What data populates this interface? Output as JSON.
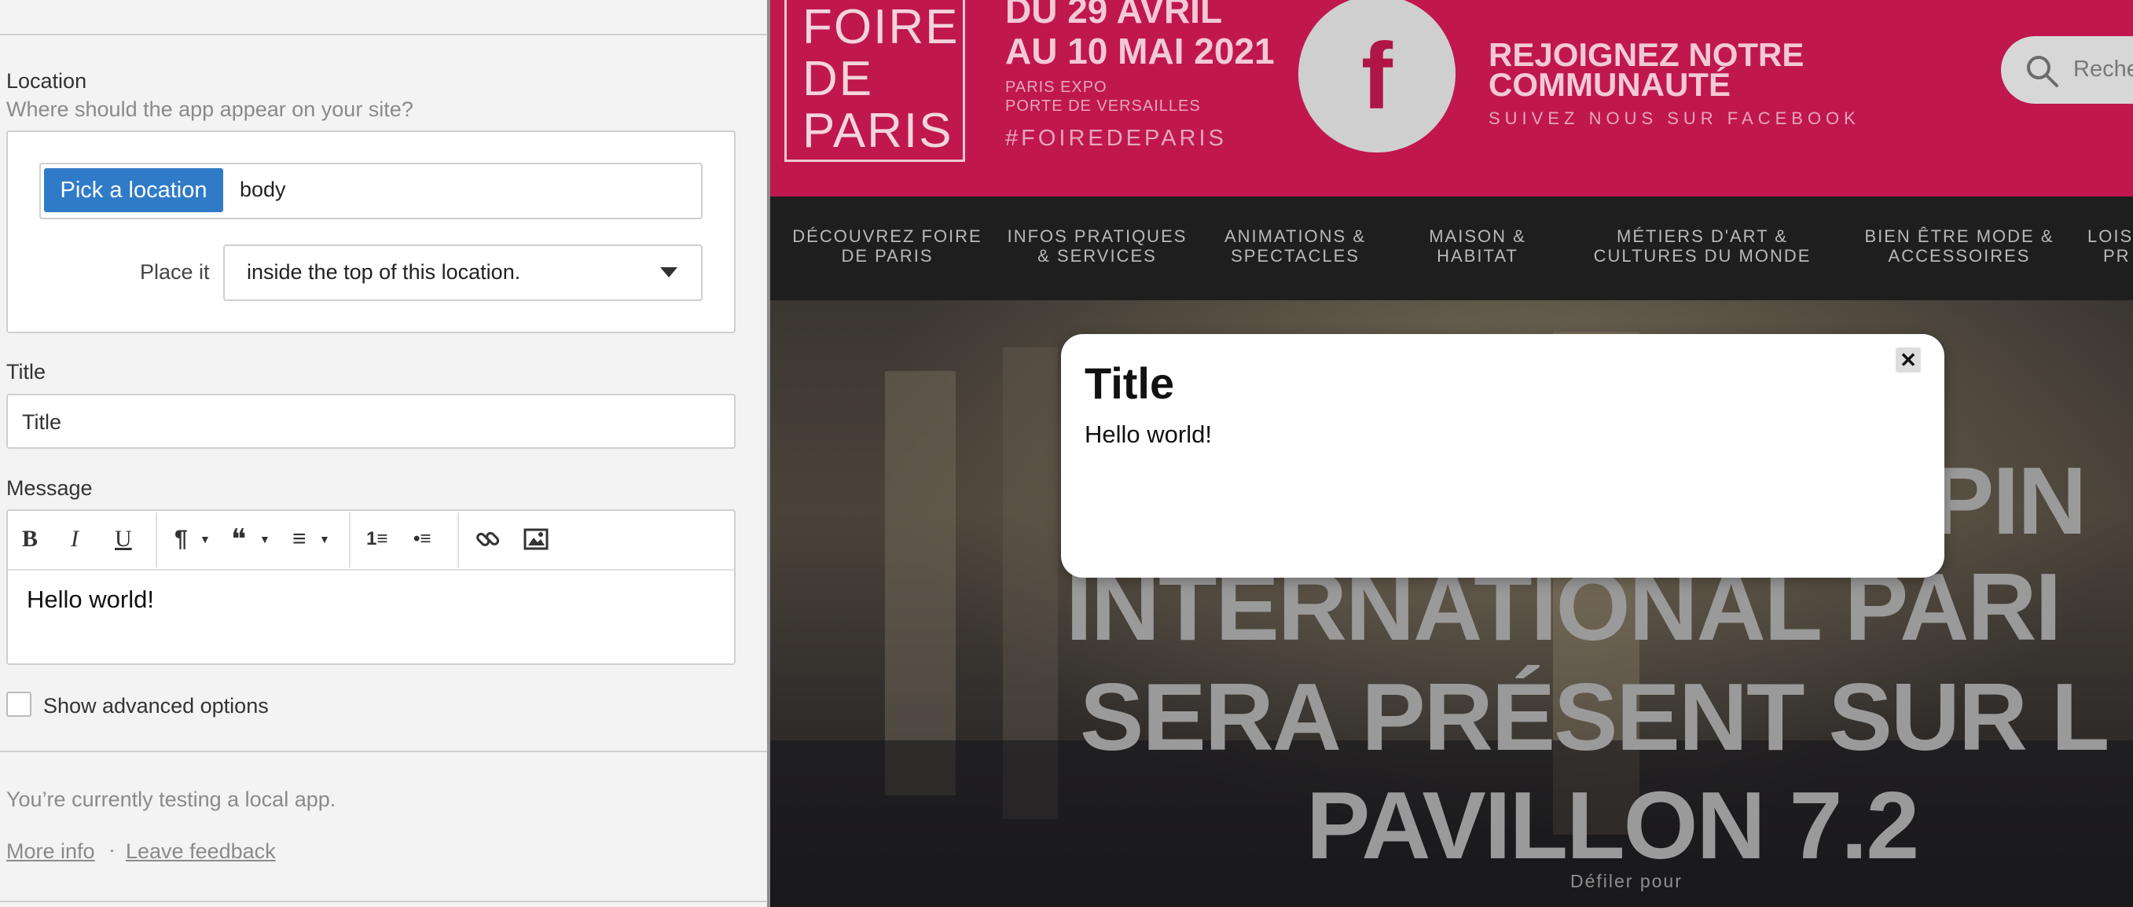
{
  "panel": {
    "location_label": "Location",
    "location_help": "Where should the app appear on your site?",
    "pick_button": "Pick a location",
    "location_value": "body",
    "place_label": "Place it",
    "place_value": "inside the top of this location.",
    "title_label": "Title",
    "title_value": "Title",
    "message_label": "Message",
    "editor_text": "Hello world!",
    "advanced_label": "Show advanced options",
    "advanced_checked": false,
    "testing_text": "You’re currently testing a local app.",
    "more_info": "More info",
    "separator": "·",
    "feedback": "Leave feedback",
    "toolbar": {
      "bold": "B",
      "italic": "I",
      "underline": "U",
      "paragraph": "¶",
      "quote": "❝",
      "align": "≡",
      "ordered_list": "1≡",
      "bullet_list": "•≡",
      "link": "🔗",
      "image": "▣"
    }
  },
  "site": {
    "logo_lines": [
      "FOIRE",
      "DE",
      "PARIS"
    ],
    "dates_line1": "DU 29 AVRIL",
    "dates_line2": "AU 10 MAI 2021",
    "venue_line1": "PARIS EXPO",
    "venue_line2": "PORTE DE VERSAILLES",
    "hashtag": "#FOIREDEPARIS",
    "facebook_glyph": "f",
    "join_line1": "REJOIGNEZ NOTRE",
    "join_line2": "COMMUNAUTÉ",
    "follow": "SUIVEZ NOUS SUR FACEBOOK",
    "search_placeholder": "Reche",
    "nav": [
      {
        "line1": "DÉCOUVREZ FOIRE",
        "line2": "DE PARIS"
      },
      {
        "line1": "INFOS PRATIQUES",
        "line2": "& SERVICES"
      },
      {
        "line1": "ANIMATIONS &",
        "line2": "SPECTACLES"
      },
      {
        "line1": "MAISON &",
        "line2": "HABITAT"
      },
      {
        "line1": "MÉTIERS D'ART &",
        "line2": "CULTURES DU MONDE"
      },
      {
        "line1": "BIEN ÊTRE MODE &",
        "line2": "ACCESSOIRES"
      },
      {
        "line1": "LOIS",
        "line2": "PR"
      }
    ],
    "hero_lines": [
      "PIN",
      "INTERNATIONAL PARI",
      "SERA PRÉSENT SUR L",
      "PAVILLON 7.2"
    ],
    "scroll_hint": "Défiler pour",
    "brand_color": "#c0174f"
  },
  "popup": {
    "title": "Title",
    "message": "Hello world!",
    "close_glyph": "✕"
  }
}
